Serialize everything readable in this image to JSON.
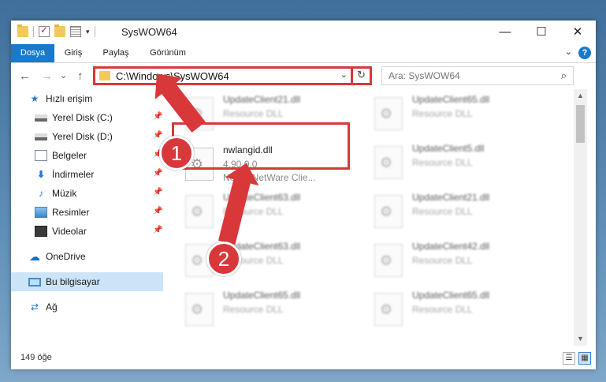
{
  "window": {
    "title": "SysWOW64",
    "controls": {
      "minimize": "—",
      "maximize": "☐",
      "close": "✕"
    }
  },
  "ribbon": {
    "tabs": [
      {
        "label": "Dosya",
        "active": true
      },
      {
        "label": "Giriş",
        "active": false
      },
      {
        "label": "Paylaş",
        "active": false
      },
      {
        "label": "Görünüm",
        "active": false
      }
    ],
    "help": "?",
    "collapse": "⌄"
  },
  "nav": {
    "back": "←",
    "forward": "→",
    "recent": "⌄",
    "up": "↑",
    "address": "C:\\Windows\\SysWOW64",
    "address_dropdown": "⌄",
    "refresh": "↻",
    "search_placeholder": "Ara: SysWOW64",
    "search_icon": "⌕"
  },
  "sidebar": {
    "items": [
      {
        "label": "Hızlı erişim",
        "icon": "star-icon",
        "glyph": "★",
        "pinned": false,
        "selected": false
      },
      {
        "label": "Yerel Disk (C:)",
        "icon": "disk-icon",
        "glyph": "",
        "pinned": true,
        "selected": false
      },
      {
        "label": "Yerel Disk (D:)",
        "icon": "disk-icon",
        "glyph": "",
        "pinned": true,
        "selected": false
      },
      {
        "label": "Belgeler",
        "icon": "document-icon",
        "glyph": "",
        "pinned": true,
        "selected": false
      },
      {
        "label": "İndirmeler",
        "icon": "download-icon",
        "glyph": "⬇",
        "pinned": true,
        "selected": false
      },
      {
        "label": "Müzik",
        "icon": "music-icon",
        "glyph": "♪",
        "pinned": true,
        "selected": false
      },
      {
        "label": "Resimler",
        "icon": "pictures-icon",
        "glyph": "",
        "pinned": true,
        "selected": false
      },
      {
        "label": "Videolar",
        "icon": "video-icon",
        "glyph": "",
        "pinned": true,
        "selected": false
      },
      {
        "label": "OneDrive",
        "icon": "cloud-icon",
        "glyph": "☁",
        "pinned": false,
        "selected": false
      },
      {
        "label": "Bu bilgisayar",
        "icon": "computer-icon",
        "glyph": "",
        "pinned": false,
        "selected": true
      },
      {
        "label": "Ağ",
        "icon": "network-icon",
        "glyph": "⇄",
        "pinned": false,
        "selected": false
      }
    ],
    "pin_glyph": "📌"
  },
  "files": {
    "left": [
      {
        "name": "UpdateClient21.dll",
        "desc": "Resource DLL",
        "desc2": "",
        "blurred": true
      },
      {
        "name": "nwlangid.dll",
        "desc": "4.90.0.0",
        "desc2": "Novell NetWare Clie...",
        "blurred": false
      },
      {
        "name": "UpdateClient63.dll",
        "desc": "Resource DLL",
        "desc2": "",
        "blurred": true
      },
      {
        "name": "UpdateClient63.dll",
        "desc": "Resource DLL",
        "desc2": "",
        "blurred": true
      },
      {
        "name": "UpdateClient65.dll",
        "desc": "Resource DLL",
        "desc2": "",
        "blurred": true
      }
    ],
    "right": [
      {
        "name": "UpdateClient65.dll",
        "desc": "Resource DLL",
        "desc2": "",
        "blurred": true
      },
      {
        "name": "UpdateClient5.dll",
        "desc": "Resource DLL",
        "desc2": "",
        "blurred": true
      },
      {
        "name": "UpdateClient21.dll",
        "desc": "Resource DLL",
        "desc2": "",
        "blurred": true
      },
      {
        "name": "UpdateClient42.dll",
        "desc": "Resource DLL",
        "desc2": "",
        "blurred": true
      },
      {
        "name": "UpdateClient65.dll",
        "desc": "Resource DLL",
        "desc2": "",
        "blurred": true
      }
    ]
  },
  "status": {
    "count": "149 öğe",
    "details_view": "☰",
    "tiles_view": "▦"
  },
  "annotations": {
    "step1": "1",
    "step2": "2",
    "color": "#d9383a"
  }
}
